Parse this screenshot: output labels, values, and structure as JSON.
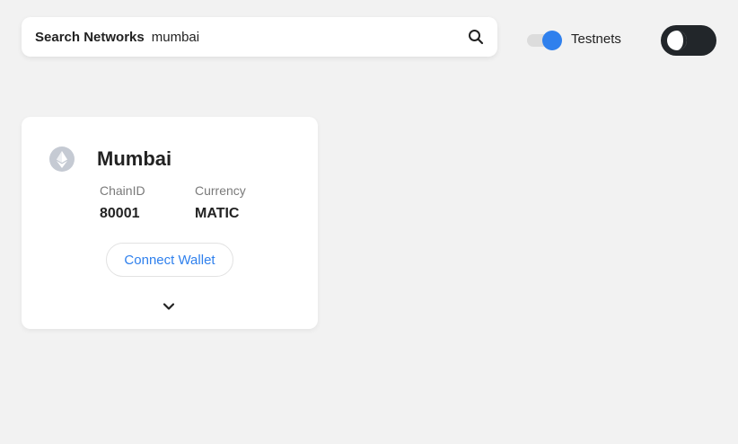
{
  "search": {
    "label": "Search Networks",
    "value": "mumbai",
    "icon": "search-icon"
  },
  "testnets": {
    "label": "Testnets",
    "enabled": true,
    "accent": "#2f80ed"
  },
  "theme_toggle": {
    "icon": "moon-icon",
    "mode": "dark"
  },
  "network": {
    "icon": "ethereum-icon",
    "name": "Mumbai",
    "chain_id_label": "ChainID",
    "chain_id": "80001",
    "currency_label": "Currency",
    "currency": "MATIC",
    "connect_label": "Connect Wallet",
    "expand_icon": "chevron-down-icon"
  }
}
